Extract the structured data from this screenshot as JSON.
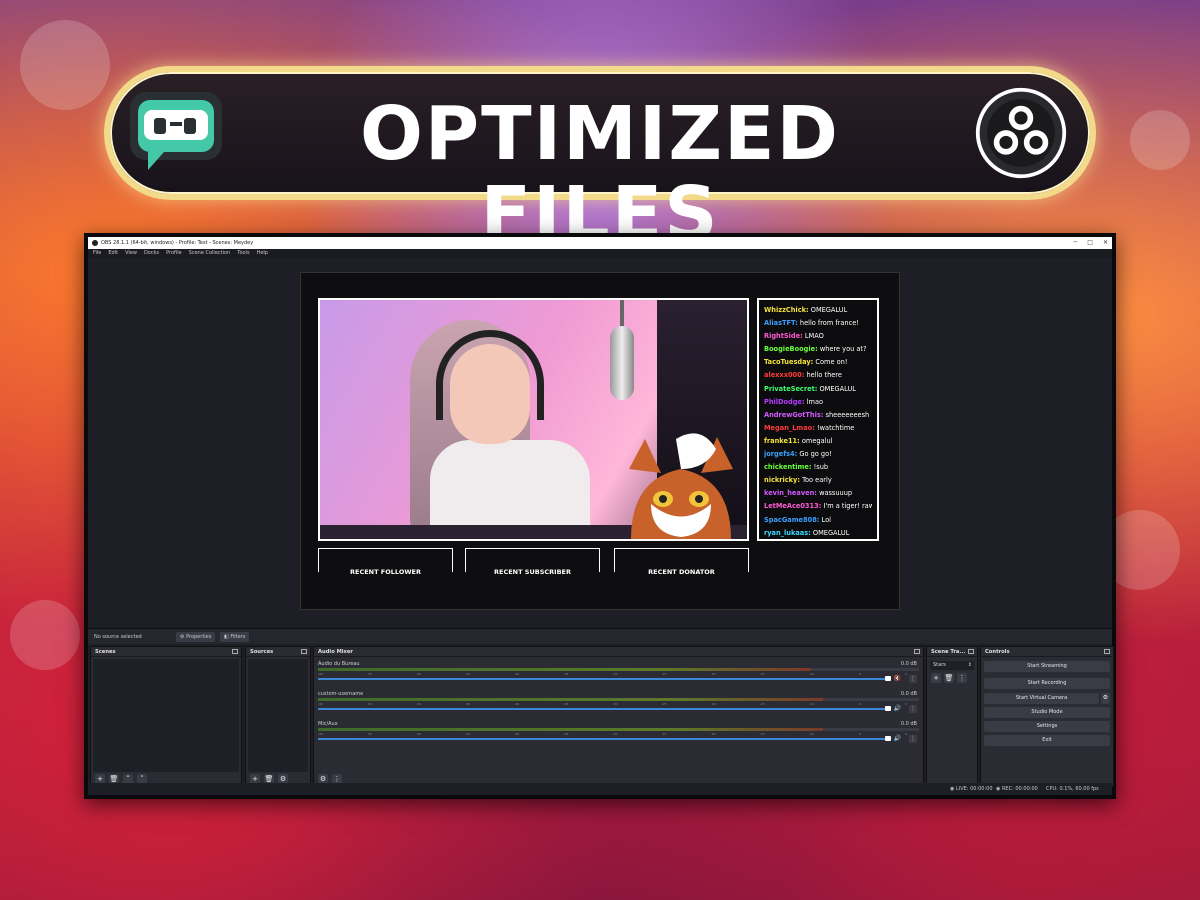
{
  "banner": {
    "title": "OPTIMIZED FILES"
  },
  "window": {
    "title": "OBS 28.1.1 (64-bit, windows) - Profile: Test - Scenes: Meydey",
    "controls": [
      "─",
      "□",
      "✕"
    ]
  },
  "menu": [
    "File",
    "Edit",
    "View",
    "Docks",
    "Profile",
    "Scene Collection",
    "Tools",
    "Help"
  ],
  "chat": [
    {
      "user": "WhizzChick:",
      "msg": "OMEGALUL",
      "color": "#f5e23a"
    },
    {
      "user": "AliasTFT:",
      "msg": "hello from france!",
      "color": "#3aa0ff"
    },
    {
      "user": "RightSide:",
      "msg": "LMAO",
      "color": "#ff5ad2"
    },
    {
      "user": "BoogieBoogie:",
      "msg": "where you at?",
      "color": "#6aff3a"
    },
    {
      "user": "TacoTuesday:",
      "msg": "Come on!",
      "color": "#f5e23a"
    },
    {
      "user": "alexxx000:",
      "msg": "hello there",
      "color": "#ff3a3a"
    },
    {
      "user": "PrivateSecret:",
      "msg": "OMEGALUL",
      "color": "#3aff6a"
    },
    {
      "user": "PhilDodge:",
      "msg": "lmao",
      "color": "#b43aff"
    },
    {
      "user": "AndrewGotThis:",
      "msg": "sheeeeeeesh",
      "color": "#d25aff"
    },
    {
      "user": "Megan_Lmao:",
      "msg": "!watchtime",
      "color": "#ff3a3a"
    },
    {
      "user": "franke11:",
      "msg": "omegalul",
      "color": "#f5e23a"
    },
    {
      "user": "jorgefs4:",
      "msg": "Go go go!",
      "color": "#3aa0ff"
    },
    {
      "user": "chickentime:",
      "msg": "!sub",
      "color": "#6aff3a"
    },
    {
      "user": "nickricky:",
      "msg": "Too early",
      "color": "#f5e23a"
    },
    {
      "user": "kevin_heaven:",
      "msg": "wassuuup",
      "color": "#d25aff"
    },
    {
      "user": "LetMeAce0313:",
      "msg": "I'm a tiger! rawr!",
      "color": "#ff5ad2"
    },
    {
      "user": "SpacGame808:",
      "msg": "Lol",
      "color": "#3aa0ff"
    },
    {
      "user": "ryan_lukaas:",
      "msg": "OMEGALUL",
      "color": "#3ad8ff"
    }
  ],
  "alerts": [
    "RECENT FOLLOWER",
    "RECENT SUBSCRIBER",
    "RECENT DONATOR"
  ],
  "source_bar": {
    "status": "No source selected",
    "properties": "Properties",
    "filters": "Filters"
  },
  "docks": {
    "scenes": "Scenes",
    "sources": "Sources",
    "mixer": "Audio Mixer",
    "transitions": "Scene Tra...",
    "controls": "Controls"
  },
  "mixer": [
    {
      "name": "Audio du Bureau",
      "db": "0.0 dB",
      "level": 0.82,
      "muted": true
    },
    {
      "name": "custom-username",
      "db": "0.0 dB",
      "level": 0.84,
      "muted": false
    },
    {
      "name": "Mic/Aux",
      "db": "0.0 dB",
      "level": 0.84,
      "muted": false
    }
  ],
  "mixer_ticks": [
    "-60",
    "-55",
    "-50",
    "-45",
    "-40",
    "-35",
    "-30",
    "-25",
    "-20",
    "-15",
    "-10",
    "-5",
    "0"
  ],
  "transition": {
    "value": "Stars"
  },
  "controls": [
    "Start Streaming",
    "Start Recording",
    "Start Virtual Camera",
    "Studio Mode",
    "Settings",
    "Exit"
  ],
  "status": {
    "live": "LIVE: 00:00:00",
    "rec": "REC: 00:00:00",
    "cpu": "CPU: 0.1%, 60.00 fps"
  },
  "colors": {
    "banner_border": "#f3d98a",
    "obs_bg": "#1e1f26",
    "slider": "#3a86d8"
  }
}
